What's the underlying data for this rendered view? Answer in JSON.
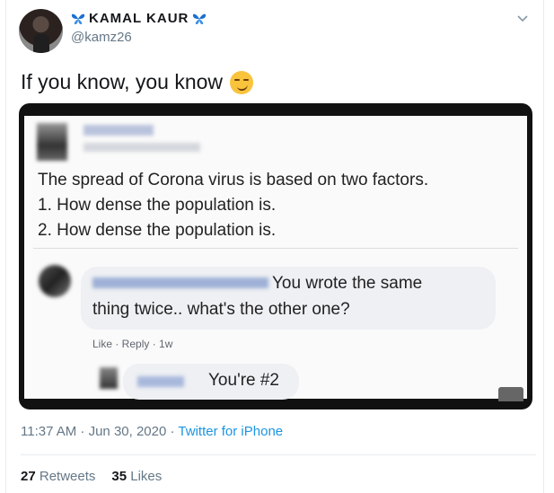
{
  "tweet": {
    "display_name": "KAMAL KAUR",
    "handle": "@kamz26",
    "text": "If you know, you know",
    "timestamp": "11:37 AM · Jun 30, 2020 ·",
    "source": "Twitter for iPhone",
    "retweets_count": "27",
    "retweets_label": "Retweets",
    "likes_count": "35",
    "likes_label": "Likes"
  },
  "embedded_image": {
    "post_text_lines": [
      "The spread of Corona virus is based on two factors.",
      "1. How dense the population is.",
      "2. How dense the population is."
    ],
    "comment1_text_line1": "You wrote the same",
    "comment1_text_line2": "thing twice.. what's the other one?",
    "comment_actions": "Like · Reply · 1w",
    "comment2_text": "You're #2"
  },
  "colors": {
    "link_blue": "#1b95e0",
    "secondary_text": "#657786",
    "primary_text": "#14171a",
    "butterfly_blue": "#1b6fd0"
  },
  "icons": [
    "butterfly-icon",
    "chevron-down-icon",
    "smirk-emoji"
  ]
}
